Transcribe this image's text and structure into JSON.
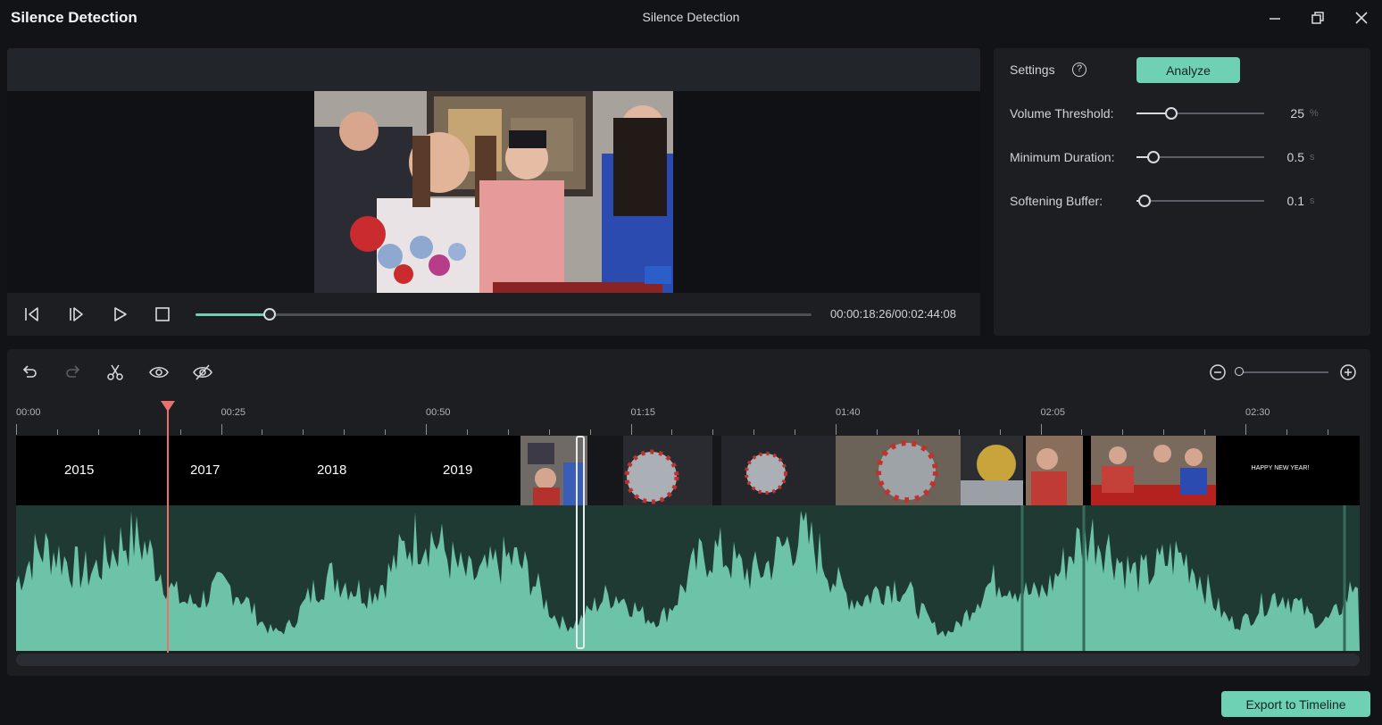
{
  "app": {
    "title": "Silence Detection",
    "window_title": "Silence Detection"
  },
  "player": {
    "timecode": "00:00:18:26/00:02:44:08",
    "progress_fraction": 0.12
  },
  "settings": {
    "label": "Settings",
    "help_glyph": "?",
    "analyze_label": "Analyze",
    "items": [
      {
        "label": "Volume Threshold:",
        "value": "25",
        "unit": "%",
        "fraction": 0.27
      },
      {
        "label": "Minimum Duration:",
        "value": "0.5",
        "unit": "s",
        "fraction": 0.13
      },
      {
        "label": "Softening Buffer:",
        "value": "0.1",
        "unit": "s",
        "fraction": 0.06
      }
    ]
  },
  "timeline": {
    "ruler_labels": [
      "00:00",
      "00:25",
      "00:50",
      "01:15",
      "01:40",
      "02:05",
      "02:30"
    ],
    "years": [
      "2015",
      "2017",
      "2018",
      "2019"
    ],
    "last_clip_text": "HAPPY NEW YEAR!",
    "zoom_fraction": 0.0
  },
  "footer": {
    "export_label": "Export to Timeline"
  },
  "colors": {
    "accent": "#6fd1b4",
    "playhead": "#e8716d",
    "waveform": "#6cc3a7",
    "waveform_bg": "#1e3a33"
  }
}
